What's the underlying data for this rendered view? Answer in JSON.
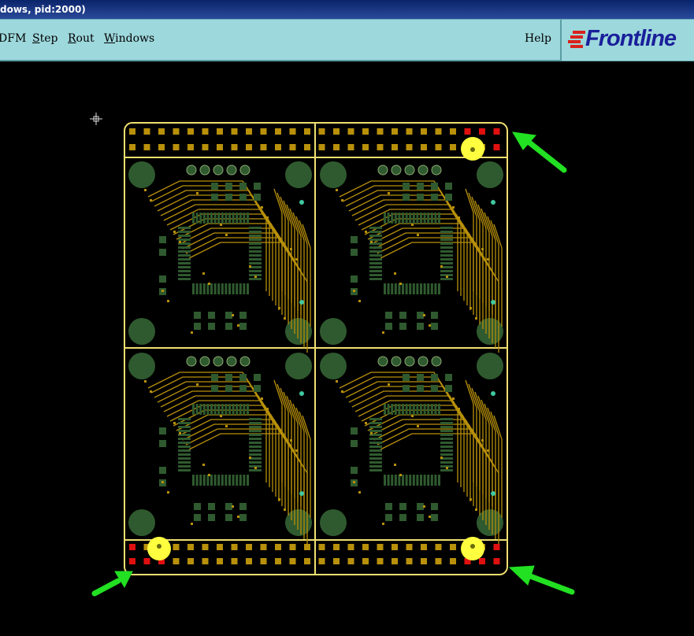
{
  "window": {
    "title": "dows, pid:2000)"
  },
  "menu": {
    "items": [
      {
        "prefix": "",
        "ul": "",
        "rest": "DFM"
      },
      {
        "prefix": "",
        "ul": "S",
        "rest": "tep"
      },
      {
        "prefix": "",
        "ul": "R",
        "rest": "out"
      },
      {
        "prefix": "",
        "ul": "W",
        "rest": "indows"
      }
    ],
    "help": {
      "ul": "",
      "rest": "Help"
    }
  },
  "logo": {
    "text": "Frontline",
    "color": "#1a1f9a",
    "accent": "#d9221c"
  },
  "board": {
    "outline_color": "#f0e070",
    "copper_color": "#b8900a",
    "pad_color": "#2f5a2f",
    "fiducial_color": "#ffff40",
    "marker_color": "#e01010",
    "arrow_color": "#22e022",
    "panels": 4
  }
}
